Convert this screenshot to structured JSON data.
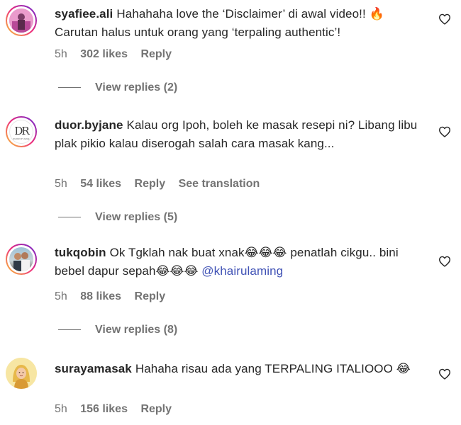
{
  "comments": [
    {
      "username": "syafiee.ali",
      "text": "Hahahaha love the ‘Disclaimer’ di awal video!! 🔥 Carutan halus untuk orang yang ‘terpaling authentic’!",
      "time": "5h",
      "likes": "302 likes",
      "reply_label": "Reply",
      "view_replies": "View replies (2)"
    },
    {
      "username": "duor.byjane",
      "text": "Kalau org Ipoh, boleh ke masak resepi ni? Libang libu plak pikio kalau diserogah salah cara masak kang...",
      "time": "5h",
      "likes": "54 likes",
      "reply_label": "Reply",
      "translation_label": "See translation",
      "view_replies": "View replies (5)",
      "avatar_text": "DR",
      "avatar_caption": "DUOR.BYJANE"
    },
    {
      "username": "tukqobin",
      "text_part1": "Ok Tgklah nak buat xnak",
      "text_part2": "penatlah cikgu.. bini bebel dapur sepah",
      "emoji_run": "😂😂😂",
      "mention": "@khairulaming",
      "time": "5h",
      "likes": "88 likes",
      "reply_label": "Reply",
      "view_replies": "View replies (8)"
    },
    {
      "username": "surayamasak",
      "text": "Hahaha risau ada yang TERPALING ITALIOOO",
      "emoji_run": "😂",
      "time": "5h",
      "likes": "156 likes",
      "reply_label": "Reply"
    }
  ],
  "icons": {
    "like": "heart-outline-icon"
  },
  "colors": {
    "text": "#262626",
    "muted": "#737373",
    "mention": "#3f51b5",
    "story_ring": [
      "#f9ce34",
      "#ee2a7b",
      "#6228d7"
    ]
  }
}
